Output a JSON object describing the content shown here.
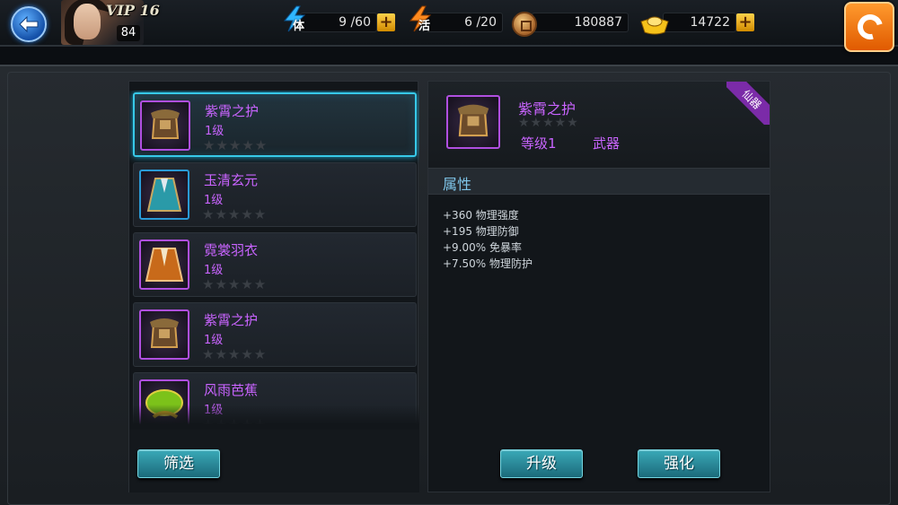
{
  "player": {
    "vip": "VIP 16",
    "level": "84"
  },
  "resources": {
    "stamina": {
      "tag": "体",
      "value": "9 /60"
    },
    "energy": {
      "tag": "活",
      "value": "6 /20"
    },
    "copper": {
      "value": "180887"
    },
    "gold": {
      "value": "14722"
    }
  },
  "equipment_list": [
    {
      "name": "紫霄之护",
      "level": "1级",
      "stars": "★★★★★",
      "selected": true
    },
    {
      "name": "玉清玄元",
      "level": "1级",
      "stars": "★★★★★",
      "selected": false
    },
    {
      "name": "霓裳羽衣",
      "level": "1级",
      "stars": "★★★★★",
      "selected": false
    },
    {
      "name": "紫霄之护",
      "level": "1级",
      "stars": "★★★★★",
      "selected": false
    },
    {
      "name": "风雨芭蕉",
      "level": "1级",
      "stars": "★★★★★",
      "selected": false
    }
  ],
  "buttons": {
    "filter": "筛选",
    "upgrade": "升级",
    "enhance": "强化"
  },
  "detail": {
    "name": "紫霄之护",
    "stars": "★★★★★",
    "grade": "等级1",
    "type": "武器",
    "ribbon": "仙器",
    "attr_title": "属性",
    "attributes": [
      "+360 物理强度",
      "+195 物理防御",
      "+9.00% 免暴率",
      "+7.50% 物理防护"
    ]
  },
  "colors": {
    "item_name": "#c964ff",
    "selected_border": "#37c9e8",
    "attr_title": "#7fc6ea",
    "button": "#2a8fa0"
  }
}
